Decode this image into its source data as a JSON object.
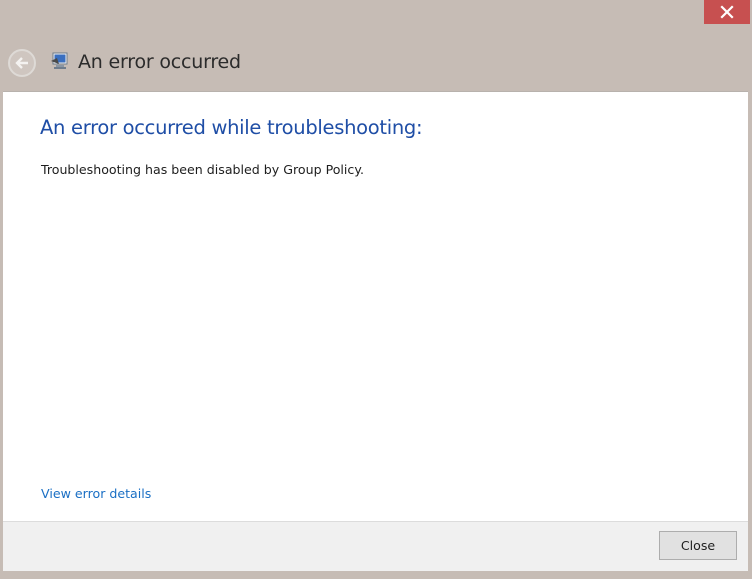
{
  "window": {
    "close_icon": "close-icon",
    "close_color": "#c75050"
  },
  "header": {
    "back_icon": "back-arrow-icon",
    "app_icon": "troubleshooter-icon",
    "title": "An error occurred"
  },
  "main": {
    "heading": "An error occurred while troubleshooting:",
    "message": "Troubleshooting has been disabled by Group Policy.",
    "details_link": "View error details",
    "heading_color": "#1f4ea6",
    "link_color": "#1a6fc4"
  },
  "footer": {
    "close_label": "Close"
  }
}
